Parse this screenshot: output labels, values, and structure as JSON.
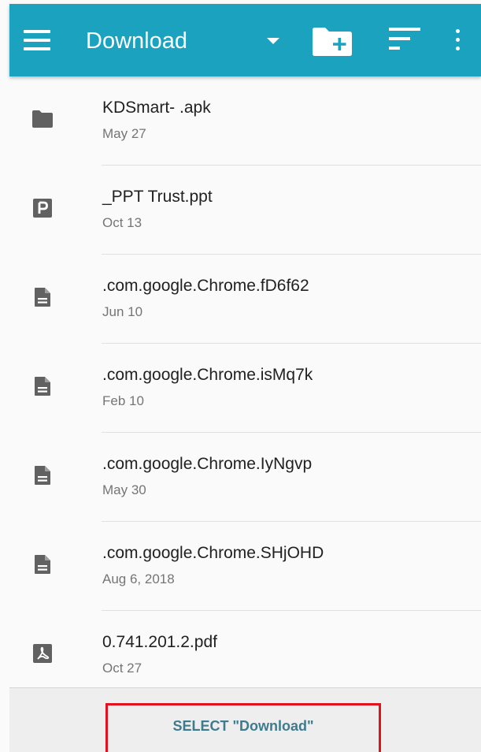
{
  "app_bar": {
    "title": "Download",
    "background": "#1ba2bf",
    "icons": [
      "menu-icon",
      "dropdown-arrow-icon",
      "new-folder-icon",
      "sort-icon",
      "more-options-icon"
    ]
  },
  "files": [
    {
      "name": "KDSmart- .apk",
      "date": "May 27",
      "icon": "folder-icon"
    },
    {
      "name": "_PPT Trust.ppt",
      "date": "Oct 13",
      "icon": "powerpoint-icon"
    },
    {
      "name": ".com.google.Chrome.fD6f62",
      "date": "Jun 10",
      "icon": "document-icon"
    },
    {
      "name": ".com.google.Chrome.isMq7k",
      "date": "Feb 10",
      "icon": "document-icon"
    },
    {
      "name": ".com.google.Chrome.IyNgvp",
      "date": "May 30",
      "icon": "document-icon"
    },
    {
      "name": ".com.google.Chrome.SHjOHD",
      "date": "Aug 6, 2018",
      "icon": "document-icon"
    },
    {
      "name": "0.741.201.2.pdf",
      "date": "Oct 27",
      "icon": "pdf-icon"
    }
  ],
  "bottom_bar": {
    "select_label": "SELECT \"Download\"",
    "highlight_color": "#e3101e"
  }
}
